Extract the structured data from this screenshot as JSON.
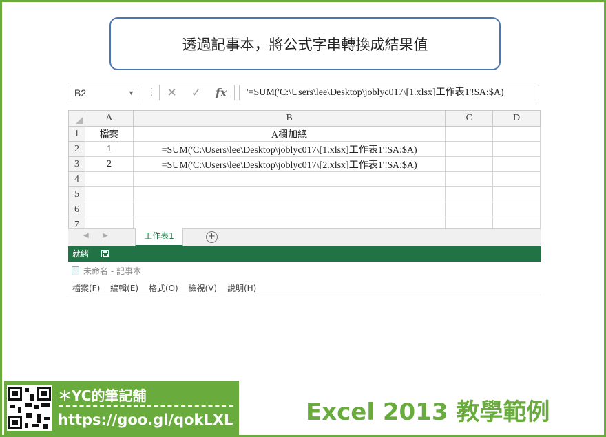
{
  "banner": {
    "title": "透過記事本，將公式字串轉換成結果值"
  },
  "formula_bar": {
    "name_box": "B2",
    "formula": "'=SUM('C:\\Users\\lee\\Desktop\\joblyc017\\[1.xlsx]工作表1'!$A:$A)"
  },
  "sheet": {
    "columns": [
      "A",
      "B",
      "C",
      "D"
    ],
    "rows": [
      {
        "num": "1",
        "a": "檔案",
        "b": "A欄加總"
      },
      {
        "num": "2",
        "a": "1",
        "b": "=SUM('C:\\Users\\lee\\Desktop\\joblyc017\\[1.xlsx]工作表1'!$A:$A)"
      },
      {
        "num": "3",
        "a": "2",
        "b": "=SUM('C:\\Users\\lee\\Desktop\\joblyc017\\[2.xlsx]工作表1'!$A:$A)"
      },
      {
        "num": "4",
        "a": "",
        "b": ""
      },
      {
        "num": "5",
        "a": "",
        "b": ""
      },
      {
        "num": "6",
        "a": "",
        "b": ""
      },
      {
        "num": "7",
        "a": "",
        "b": ""
      }
    ],
    "tab": "工作表1"
  },
  "status": {
    "ready": "就緒"
  },
  "notepad": {
    "title": "未命名 - 記事本",
    "menu": [
      "檔案(F)",
      "編輯(E)",
      "格式(O)",
      "檢視(V)",
      "說明(H)"
    ]
  },
  "footer": {
    "brand": "＊YC的筆記舖",
    "url": "https://goo.gl/qokLXL",
    "course": "Excel 2013 教學範例"
  },
  "colors": {
    "frame": "#6aab3d",
    "excel_green": "#217346",
    "banner_border": "#4a76b6"
  }
}
